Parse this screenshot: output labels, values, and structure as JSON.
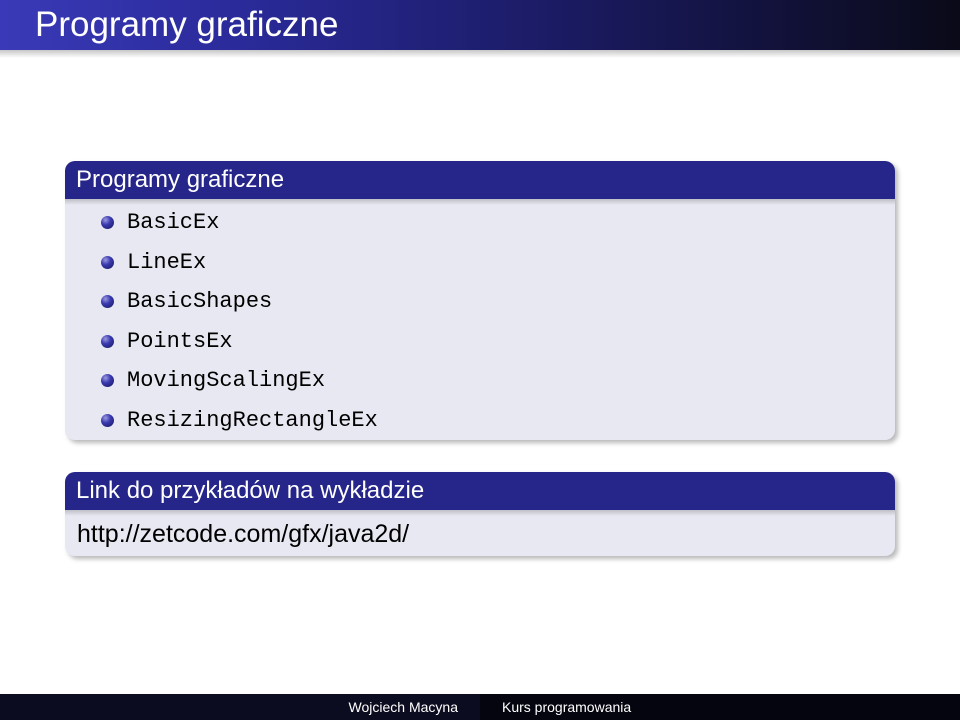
{
  "header": {
    "title": "Programy graficzne"
  },
  "block1": {
    "title": "Programy graficzne",
    "items": [
      "BasicEx",
      "LineEx",
      "BasicShapes",
      "PointsEx",
      "MovingScalingEx",
      "ResizingRectangleEx"
    ]
  },
  "block2": {
    "title": "Link do przykładów na wykładzie",
    "url": "http://zetcode.com/gfx/java2d/"
  },
  "footer": {
    "author": "Wojciech Macyna",
    "course": "Kurs programowania"
  },
  "colors": {
    "header_start": "#3a3ab8",
    "header_end": "#0a0a18",
    "block_title_bg": "#25258a",
    "block_body_bg": "#e8e8f2",
    "footer_bg": "#0c0c20"
  }
}
